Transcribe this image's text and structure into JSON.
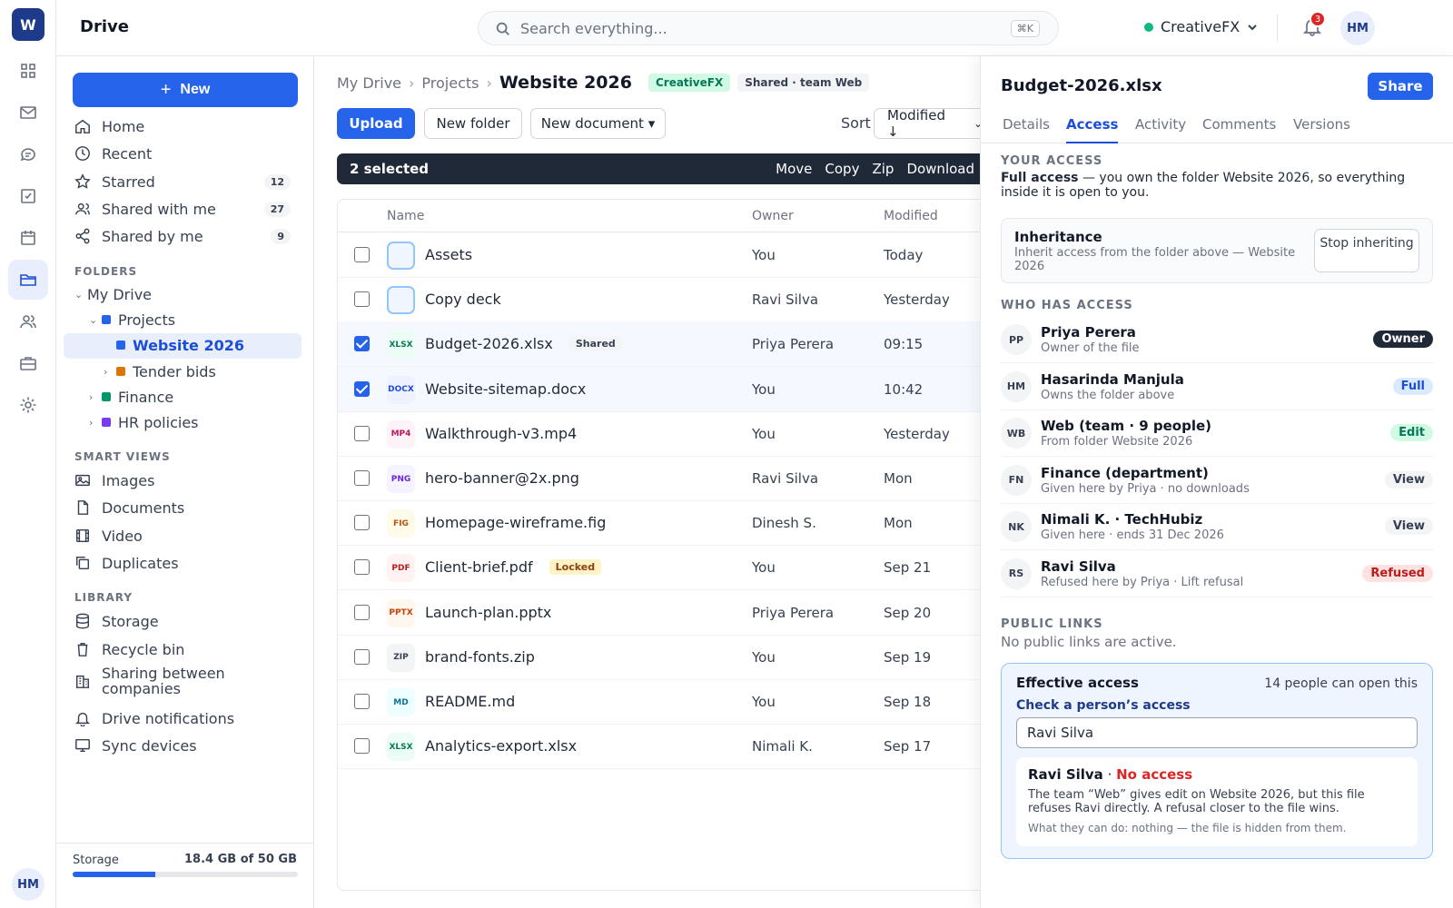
{
  "app": {
    "logo_letter": "W",
    "title": "Drive",
    "user_initials": "HM"
  },
  "search": {
    "placeholder": "Search everything...",
    "shortcut": "⌘K"
  },
  "org": {
    "name": "CreativeFX",
    "color": "#10b981"
  },
  "notifications": {
    "count": "3"
  },
  "sidebar": {
    "new_label": "New",
    "nav": [
      {
        "label": "Home",
        "icon": "home-icon"
      },
      {
        "label": "Recent",
        "icon": "clock-icon"
      },
      {
        "label": "Starred",
        "icon": "star-icon",
        "count": "12"
      },
      {
        "label": "Shared with me",
        "icon": "users-icon",
        "count": "27"
      },
      {
        "label": "Shared by me",
        "icon": "share-icon",
        "count": "9"
      }
    ],
    "folders_label": "FOLDERS",
    "tree": [
      {
        "label": "My Drive"
      },
      {
        "label": "Projects",
        "color": "#2563eb"
      },
      {
        "label": "Website 2026",
        "color": "#2563eb"
      },
      {
        "label": "Tender bids",
        "color": "#d97706"
      },
      {
        "label": "Finance",
        "color": "#059669"
      },
      {
        "label": "HR policies",
        "color": "#7c3aed"
      }
    ],
    "smart_label": "SMART VIEWS",
    "smart": [
      {
        "label": "Images"
      },
      {
        "label": "Documents"
      },
      {
        "label": "Video"
      },
      {
        "label": "Duplicates"
      }
    ],
    "library_label": "LIBRARY",
    "library": [
      {
        "label": "Storage"
      },
      {
        "label": "Recycle bin"
      },
      {
        "label": "Sharing between companies"
      },
      {
        "label": "Drive notifications"
      },
      {
        "label": "Sync devices"
      }
    ],
    "storage": {
      "label": "Storage",
      "value": "18.4 GB of 50 GB",
      "used_fraction": 0.368
    }
  },
  "main": {
    "breadcrumb": [
      "My Drive",
      "Projects",
      "Website 2026"
    ],
    "org_tag": "CreativeFX",
    "shared_tag": "Shared · team Web",
    "upload_label": "Upload",
    "new_folder_label": "New folder",
    "new_document_label": "New document ▾",
    "sort_label": "Sort",
    "sort_value": "Modified ↓",
    "selection": {
      "count_label": "2 selected",
      "actions": [
        "Move",
        "Copy",
        "Zip",
        "Download"
      ]
    },
    "columns": {
      "name": "Name",
      "owner": "Owner",
      "modified": "Modified"
    },
    "rows": [
      {
        "type": "folder",
        "name": "Assets",
        "owner": "You",
        "modified": "Today",
        "selected": false
      },
      {
        "type": "folder",
        "name": "Copy deck",
        "owner": "Ravi Silva",
        "modified": "Yesterday",
        "selected": false
      },
      {
        "type": "XLSX",
        "name": "Budget-2026.xlsx",
        "badge": "Shared",
        "owner": "Priya Perera",
        "modified": "09:15",
        "selected": true
      },
      {
        "type": "DOCX",
        "name": "Website-sitemap.docx",
        "owner": "You",
        "modified": "10:42",
        "selected": true
      },
      {
        "type": "MP4",
        "name": "Walkthrough-v3.mp4",
        "owner": "You",
        "modified": "Yesterday",
        "selected": false
      },
      {
        "type": "PNG",
        "name": "hero-banner@2x.png",
        "owner": "Ravi Silva",
        "modified": "Mon",
        "selected": false
      },
      {
        "type": "FIG",
        "name": "Homepage-wireframe.fig",
        "owner": "Dinesh S.",
        "modified": "Mon",
        "selected": false
      },
      {
        "type": "PDF",
        "name": "Client-brief.pdf",
        "badge": "Locked",
        "owner": "You",
        "modified": "Sep 21",
        "selected": false
      },
      {
        "type": "PPTX",
        "name": "Launch-plan.pptx",
        "owner": "Priya Perera",
        "modified": "Sep 20",
        "selected": false
      },
      {
        "type": "ZIP",
        "name": "brand-fonts.zip",
        "owner": "You",
        "modified": "Sep 19",
        "selected": false
      },
      {
        "type": "MD",
        "name": "README.md",
        "owner": "You",
        "modified": "Sep 18",
        "selected": false
      },
      {
        "type": "XLSX",
        "name": "Analytics-export.xlsx",
        "owner": "Nimali K.",
        "modified": "Sep 17",
        "selected": false
      }
    ]
  },
  "panel": {
    "title": "Budget-2026.xlsx",
    "share_label": "Share",
    "tabs": [
      "Details",
      "Access",
      "Activity",
      "Comments",
      "Versions"
    ],
    "active_tab": "Access",
    "your_access_label": "YOUR ACCESS",
    "your_access_strong": "Full access",
    "your_access_text": " — you own the folder Website 2026, so everything inside it is open to you.",
    "inheritance": {
      "title": "Inheritance",
      "desc": "Inherit access from the folder above — Website 2026",
      "button": "Stop inheriting"
    },
    "who_label": "WHO HAS ACCESS",
    "people": [
      {
        "initials": "PP",
        "name": "Priya Perera",
        "sub": "Owner of the file",
        "role": "Owner"
      },
      {
        "initials": "HM",
        "name": "Hasarinda Manjula",
        "sub": "Owns the folder above",
        "role": "Full"
      },
      {
        "initials": "WB",
        "name": "Web (team · 9 people)",
        "sub": "From folder Website 2026",
        "role": "Edit"
      },
      {
        "initials": "FN",
        "name": "Finance (department)",
        "sub": "Given here by Priya · no downloads",
        "role": "View"
      },
      {
        "initials": "NK",
        "name": "Nimali K. · TechHubiz",
        "sub": "Given here · ends 31 Dec 2026",
        "role": "View"
      },
      {
        "initials": "RS",
        "name": "Ravi Silva",
        "sub": "Refused here by Priya · Lift refusal",
        "role": "Refused"
      }
    ],
    "public_label": "PUBLIC LINKS",
    "public_text": "No public links are active.",
    "effective": {
      "title": "Effective access",
      "count": "14 people can open this",
      "check_label": "Check a person’s access",
      "input_value": "Ravi Silva",
      "result_name": "Ravi Silva",
      "result_sep": " · ",
      "result_status": "No access",
      "result_reason": "The team “Web” gives edit on Website 2026, but this file refuses Ravi directly. A refusal closer to the file wins.",
      "result_can": "What they can do: nothing — the file is hidden from them."
    }
  }
}
